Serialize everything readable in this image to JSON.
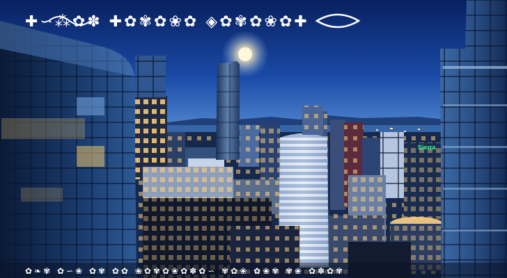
{
  "scene": {
    "description_visible_text": "",
    "dingbat_title": "✚∽⁂✿✽ ✚✿✾✿❀✿ ◈✿✾✿❀✿✚",
    "dingbat_footer": "✿❧✾ ✿∽❀ ✿✾ ✿✿ ❀✿✾✿❀✿✽✿∽ ✾✿❀ ✿❀✾ ✾❀ ✿✽✿✾"
  },
  "colors": {
    "sky_top": "#0a2a7a",
    "sky_mid": "#1d54b8",
    "sky_horizon": "#4a86d6",
    "water": "#2b5a9a",
    "glass_dark": "#0d1f3f",
    "glass_mid": "#1c3d70",
    "glass_light": "#3f6fae",
    "window_warm": "#ffcf6b",
    "moon": "#fff7dc",
    "sign_green": "#3cff9a",
    "ornament": "#ffffff"
  },
  "icons": {
    "moon": "moon-icon",
    "sign": "building-sign"
  },
  "sign_text": "Sierra"
}
